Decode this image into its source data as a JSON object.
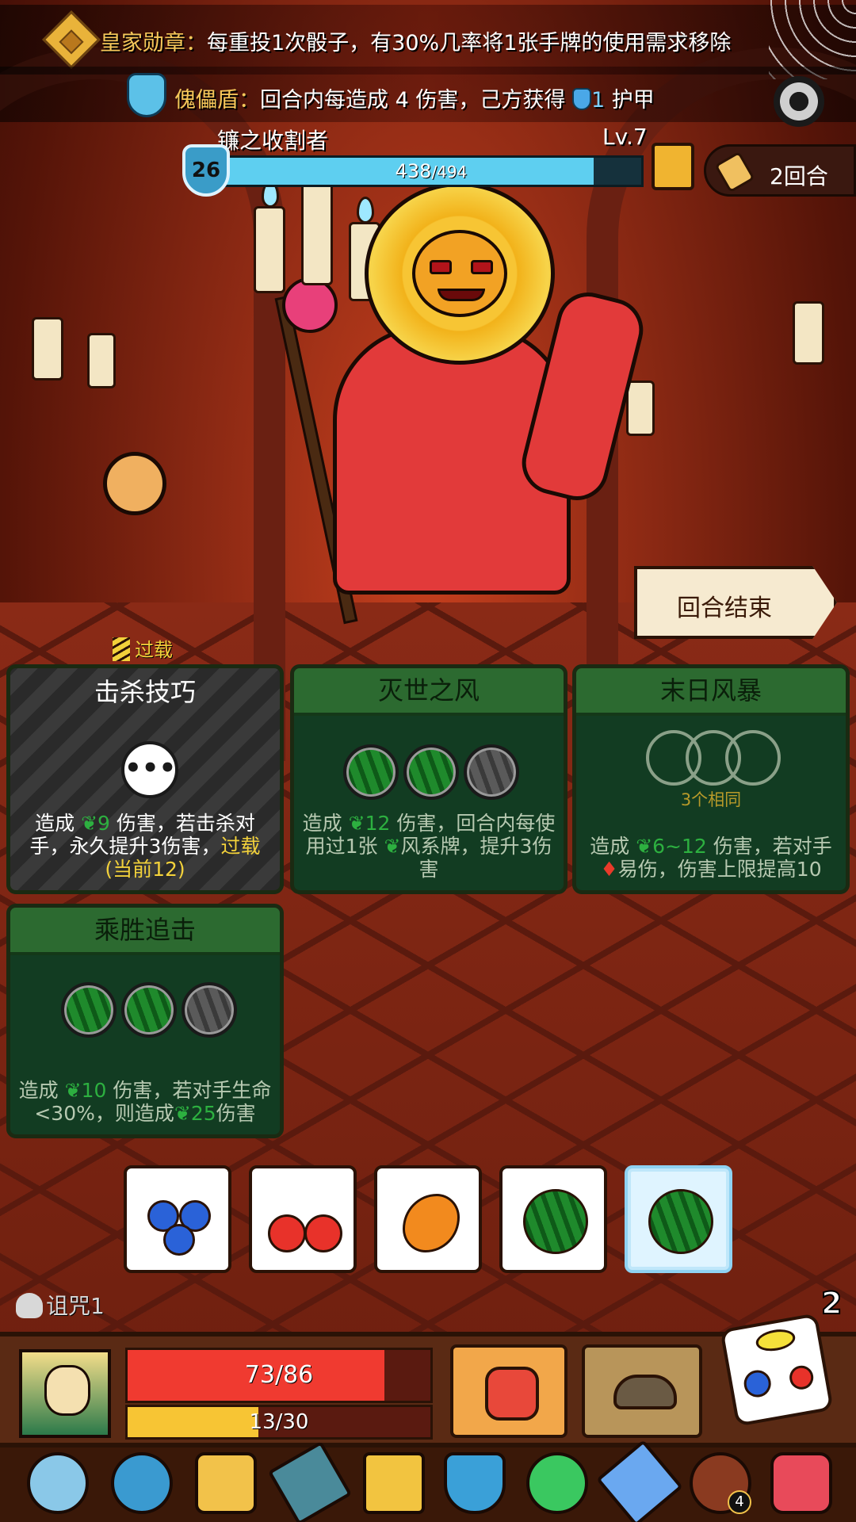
{
  "top_banners": {
    "medal": {
      "label": "皇家勋章：",
      "text": "每重投1次骰子，有30%几率将1张手牌的使用需求移除"
    },
    "shield": {
      "label": "傀儡盾：",
      "text_before": "回合内每造成 4 伤害，己方获得",
      "armor_amount": "1",
      "text_after": "护甲"
    }
  },
  "boss": {
    "name": "镰之收割者",
    "level": "Lv.7",
    "armor": "26",
    "hp": "438",
    "hp_max": "/494",
    "hp_ratio": 0.887
  },
  "turn": {
    "label": "2回合"
  },
  "end_turn_button": "回合结束",
  "cards": [
    {
      "title": "击杀技巧",
      "status": "过载",
      "body_pre": "造成 ",
      "dmg": "9",
      "body_post": " 伤害，若击杀对手，永久提升3伤害，",
      "keyword": "过载",
      "current": "(当前12)"
    },
    {
      "title": "灭世之风",
      "body": "造成 ",
      "dmg": "12",
      "body_post": " 伤害，回合内每使用过1张 ",
      "body_tail": "风系牌，提升3伤害"
    },
    {
      "title": "末日风暴",
      "slots_hint": "3个相同",
      "body": "造成 ",
      "dmg": "6~12",
      "body_mid": " 伤害，若对手 ",
      "body_post": "易伤，伤害上限提高10"
    },
    {
      "title": "乘胜追击",
      "body": "造成 ",
      "dmg": "10",
      "body_mid": " 伤害，若对手生命<30%，则造成",
      "dmg2": "25",
      "body_post": "伤害"
    }
  ],
  "dice": [
    "blueberry",
    "cherry",
    "mango",
    "watermelon",
    "watermelon-frozen"
  ],
  "curse": {
    "label": "诅咒1"
  },
  "rerolls": "2",
  "player": {
    "hp_text": "73/86",
    "hp_ratio": 0.849,
    "energy_text": "13/30",
    "energy_ratio": 0.433
  },
  "relics": [
    "ring-icon",
    "crystal-mask-icon",
    "dice-monster-icon",
    "dagger-icon",
    "gold-box-icon",
    "shield-relic-icon",
    "leaf-icon",
    "ice-sword-icon",
    "button-icon",
    "potion-icon"
  ],
  "relic_badge": "4",
  "colors": {
    "accent_gold": "#f4c85a",
    "armor_blue": "#5ecff0",
    "wind_green": "#2db040",
    "hp_red": "#f03a30",
    "energy_yellow": "#f7c534"
  }
}
